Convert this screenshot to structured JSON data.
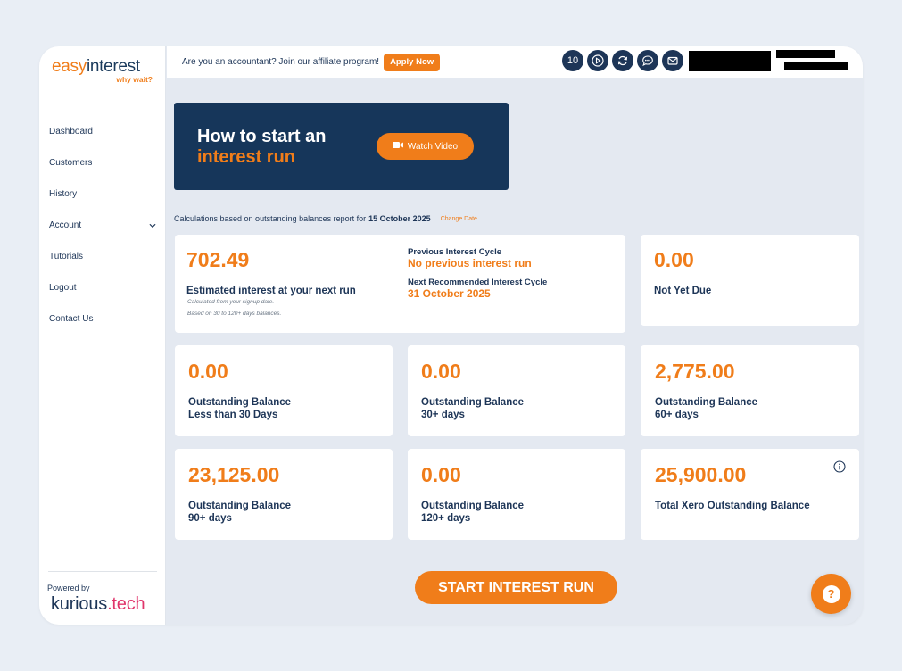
{
  "sidebar": {
    "logo": {
      "easy": "easy",
      "interest": "interest",
      "tagline": "why wait?"
    },
    "items": [
      {
        "label": "Dashboard"
      },
      {
        "label": "Customers"
      },
      {
        "label": "History"
      },
      {
        "label": "Account"
      },
      {
        "label": "Tutorials"
      },
      {
        "label": "Logout"
      },
      {
        "label": "Contact Us"
      }
    ],
    "powered_by": "Powered by",
    "brand": {
      "part1": "kurious",
      "part2": ".tech"
    }
  },
  "topbar": {
    "affiliate_text": "Are you an accountant? Join our affiliate program!",
    "apply_label": "Apply Now",
    "counter": "10",
    "icons": [
      "play-icon",
      "refresh-icon",
      "chat-icon",
      "mail-icon"
    ]
  },
  "banner": {
    "line1": "How to start an",
    "line2": "interest run",
    "watch_label": "Watch Video"
  },
  "calc": {
    "prefix": "Calculations based on outstanding balances report for",
    "date": "15 October 2025",
    "change_label": "Change Date"
  },
  "estimate": {
    "value": "702.49",
    "label": "Estimated interest at your next run",
    "note1": "Calculated from your signup date.",
    "note2": "Based on 30 to 120+ days balances.",
    "prev_heading": "Previous Interest Cycle",
    "prev_value": "No previous interest run",
    "next_heading": "Next Recommended Interest Cycle",
    "next_value": "31 October 2025"
  },
  "not_yet_due": {
    "value": "0.00",
    "label": "Not Yet Due"
  },
  "balances": [
    {
      "value": "0.00",
      "line1": "Outstanding Balance",
      "line2": "Less than 30 Days"
    },
    {
      "value": "0.00",
      "line1": "Outstanding Balance",
      "line2": "30+ days"
    },
    {
      "value": "2,775.00",
      "line1": "Outstanding Balance",
      "line2": "60+ days"
    },
    {
      "value": "23,125.00",
      "line1": "Outstanding Balance",
      "line2": "90+ days"
    },
    {
      "value": "0.00",
      "line1": "Outstanding Balance",
      "line2": "120+ days"
    }
  ],
  "total": {
    "value": "25,900.00",
    "label": "Total Xero Outstanding Balance"
  },
  "start_label": "START INTEREST RUN",
  "help_label": "?",
  "colors": {
    "accent": "#f07d1a",
    "navy": "#1d3557",
    "brand_pink": "#e0356b"
  }
}
